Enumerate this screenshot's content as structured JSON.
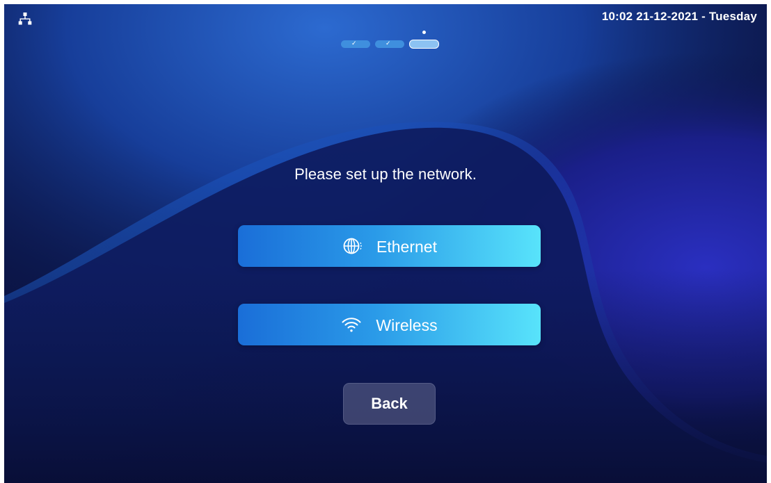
{
  "status_bar": {
    "network_icon": "network-topology-icon",
    "datetime": "10:02  21-12-2021 - Tuesday"
  },
  "progress": {
    "total_steps": 3,
    "completed_steps": 2,
    "current_step": 3
  },
  "setup": {
    "prompt": "Please set up the network.",
    "options": [
      {
        "label": "Ethernet",
        "icon": "ethernet-globe-icon"
      },
      {
        "label": "Wireless",
        "icon": "wifi-icon"
      }
    ],
    "back_label": "Back"
  },
  "colors": {
    "background": "#0a1140",
    "button_gradient_start": "#1a6ed8",
    "button_gradient_end": "#58e3fb",
    "back_button": "#5e6282",
    "text": "#ffffff"
  }
}
